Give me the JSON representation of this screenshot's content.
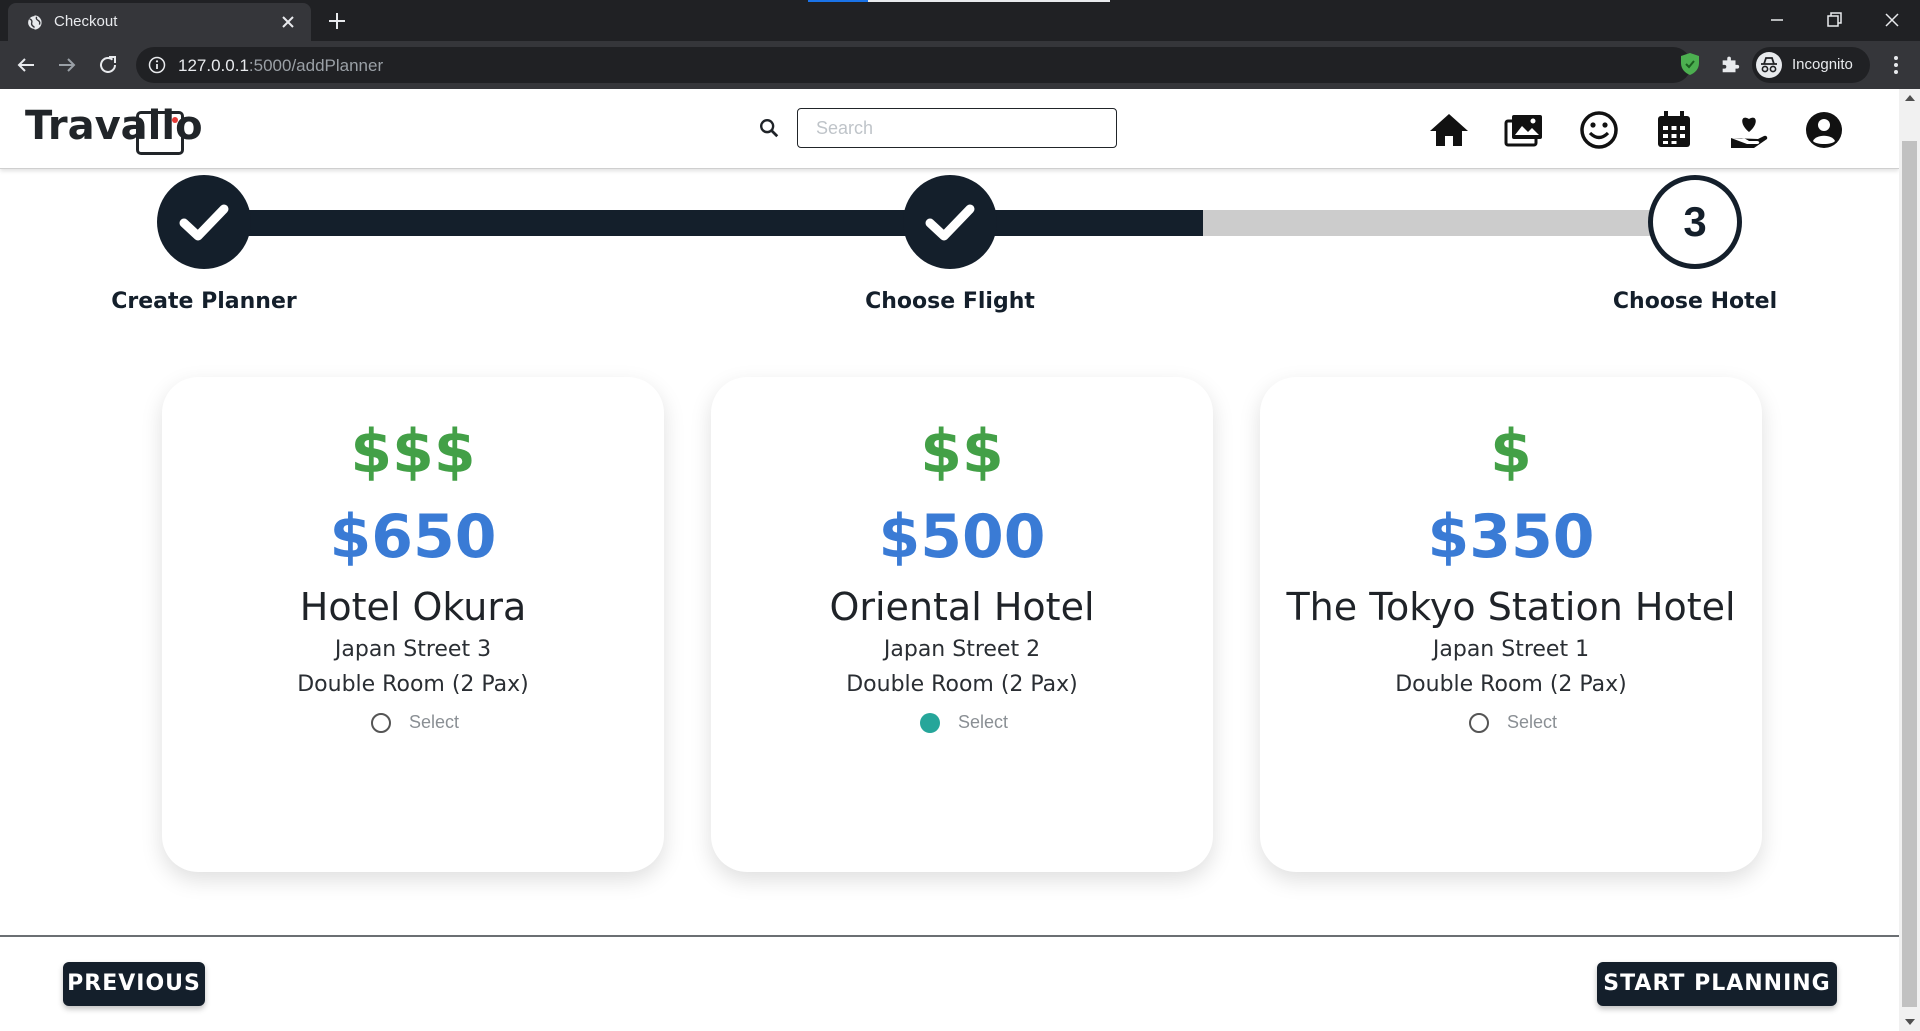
{
  "browser": {
    "tab_title": "Checkout",
    "url_host": "127.0.0.1",
    "url_path": ":5000/addPlanner",
    "profile_label": "Incognito"
  },
  "site": {
    "brand": "Travallo",
    "search_placeholder": "Search",
    "nav_icons": [
      "home-icon",
      "gallery-icon",
      "smiley-icon",
      "calendar-icon",
      "care-hand-icon",
      "account-icon"
    ]
  },
  "stepper": {
    "progress_fraction": 0.74,
    "steps": [
      {
        "label": "Create Planner",
        "status": "done"
      },
      {
        "label": "Choose Flight",
        "status": "done"
      },
      {
        "label": "Choose Hotel",
        "status": "current",
        "number": "3"
      }
    ]
  },
  "hotels": [
    {
      "tier": "$$$",
      "price": "$650",
      "name": "Hotel Okura",
      "address": "Japan Street 3",
      "room": "Double Room (2 Pax)",
      "select_label": "Select",
      "selected": false
    },
    {
      "tier": "$$",
      "price": "$500",
      "name": "Oriental Hotel",
      "address": "Japan Street 2",
      "room": "Double Room (2 Pax)",
      "select_label": "Select",
      "selected": true
    },
    {
      "tier": "$",
      "price": "$350",
      "name": "The Tokyo Station Hotel",
      "address": "Japan Street 1",
      "room": "Double Room (2 Pax)",
      "select_label": "Select",
      "selected": false
    }
  ],
  "footer": {
    "previous_label": "PREVIOUS",
    "start_label": "START PLANNING"
  },
  "colors": {
    "dark_navy": "#141f2b",
    "tier_green": "#43a047",
    "price_blue": "#3a7bd5",
    "radio_selected": "#26a69a"
  }
}
